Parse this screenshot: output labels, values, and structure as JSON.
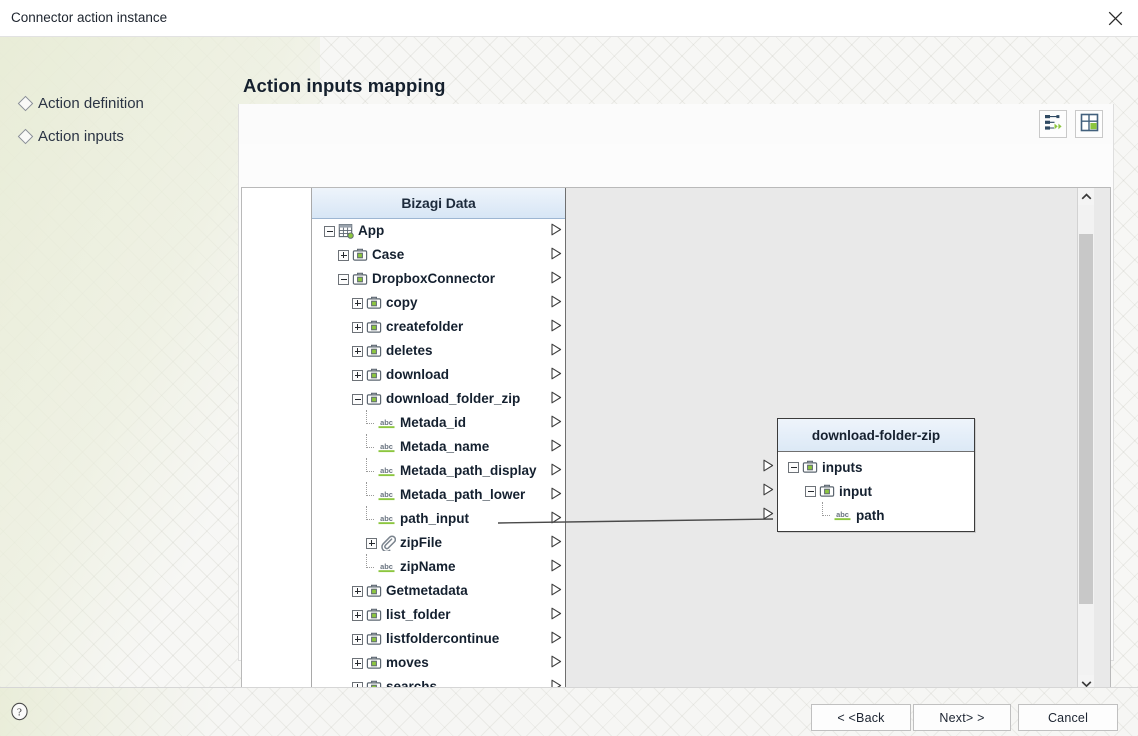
{
  "window": {
    "title": "Connector action instance",
    "close_icon": "close-icon"
  },
  "nav": {
    "items": [
      {
        "label": "Action definition",
        "bullet_icon": "diamond-bullet-icon"
      },
      {
        "label": "Action inputs",
        "bullet_icon": "diamond-bullet-icon"
      }
    ]
  },
  "page": {
    "title": "Action inputs mapping"
  },
  "toolbar": {
    "buttons": [
      {
        "name": "auto-map-button",
        "icon": "auto-map-icon",
        "tooltip": "Auto map"
      },
      {
        "name": "auto-layout-button",
        "icon": "auto-layout-icon",
        "tooltip": "Auto layout"
      }
    ]
  },
  "tree": {
    "header": "Bizagi Data",
    "rows": [
      {
        "label": "App",
        "indent": 0,
        "expander": "minus",
        "icon": "entity-grid-icon",
        "arrow": true
      },
      {
        "label": "Case",
        "indent": 1,
        "expander": "plus",
        "icon": "briefcase-icon",
        "arrow": true
      },
      {
        "label": "DropboxConnector",
        "indent": 1,
        "expander": "minus",
        "icon": "briefcase-icon",
        "arrow": true
      },
      {
        "label": "copy",
        "indent": 2,
        "expander": "plus",
        "icon": "briefcase-icon",
        "arrow": true
      },
      {
        "label": "createfolder",
        "indent": 2,
        "expander": "plus",
        "icon": "briefcase-icon",
        "arrow": true
      },
      {
        "label": "deletes",
        "indent": 2,
        "expander": "plus",
        "icon": "briefcase-icon",
        "arrow": true
      },
      {
        "label": "download",
        "indent": 2,
        "expander": "plus",
        "icon": "briefcase-icon",
        "arrow": true
      },
      {
        "label": "download_folder_zip",
        "indent": 2,
        "expander": "minus",
        "icon": "briefcase-icon",
        "arrow": true
      },
      {
        "label": "Metada_id",
        "indent": 3,
        "expander": "leaf",
        "icon": "abc-attribute-icon",
        "arrow": true
      },
      {
        "label": "Metada_name",
        "indent": 3,
        "expander": "leaf",
        "icon": "abc-attribute-icon",
        "arrow": true
      },
      {
        "label": "Metada_path_display",
        "indent": 3,
        "expander": "leaf",
        "icon": "abc-attribute-icon",
        "arrow": true
      },
      {
        "label": "Metada_path_lower",
        "indent": 3,
        "expander": "leaf",
        "icon": "abc-attribute-icon",
        "arrow": true
      },
      {
        "label": "path_input",
        "indent": 3,
        "expander": "leaf",
        "icon": "abc-attribute-icon",
        "arrow": true
      },
      {
        "label": "zipFile",
        "indent": 3,
        "expander": "plus",
        "icon": "paperclip-icon",
        "arrow": true
      },
      {
        "label": "zipName",
        "indent": 3,
        "expander": "leaf",
        "icon": "abc-attribute-icon",
        "arrow": true
      },
      {
        "label": "Getmetadata",
        "indent": 2,
        "expander": "plus",
        "icon": "briefcase-icon",
        "arrow": true
      },
      {
        "label": "list_folder",
        "indent": 2,
        "expander": "plus",
        "icon": "briefcase-icon",
        "arrow": true
      },
      {
        "label": "listfoldercontinue",
        "indent": 2,
        "expander": "plus",
        "icon": "briefcase-icon",
        "arrow": true
      },
      {
        "label": "moves",
        "indent": 2,
        "expander": "plus",
        "icon": "briefcase-icon",
        "arrow": true
      },
      {
        "label": "searchs",
        "indent": 2,
        "expander": "plus",
        "icon": "briefcase-icon",
        "arrow": true
      }
    ]
  },
  "node": {
    "title": "download-folder-zip",
    "rows": [
      {
        "label": "inputs",
        "indent": 0,
        "expander": "minus",
        "icon": "briefcase-icon",
        "in_arrow": true
      },
      {
        "label": "input",
        "indent": 1,
        "expander": "minus",
        "icon": "briefcase-icon",
        "in_arrow": true
      },
      {
        "label": "path",
        "indent": 2,
        "expander": "leaf",
        "icon": "abc-attribute-icon",
        "in_arrow": true
      }
    ]
  },
  "mapping": {
    "links": [
      {
        "from": "path_input",
        "to": "path"
      }
    ]
  },
  "scrollbar": {
    "up_icon": "chevron-up-icon",
    "down_icon": "chevron-down-icon"
  },
  "footer": {
    "help_icon": "help-question-icon",
    "back_label": "< <Back",
    "next_label": "Next> >",
    "cancel_label": "Cancel"
  },
  "colors": {
    "header_blue_top": "#eef4fb",
    "header_blue_bottom": "#d7e6f5",
    "canvas_gray": "#e9e9e9",
    "icon_green": "#8cc63f",
    "text_dark": "#14202f"
  }
}
